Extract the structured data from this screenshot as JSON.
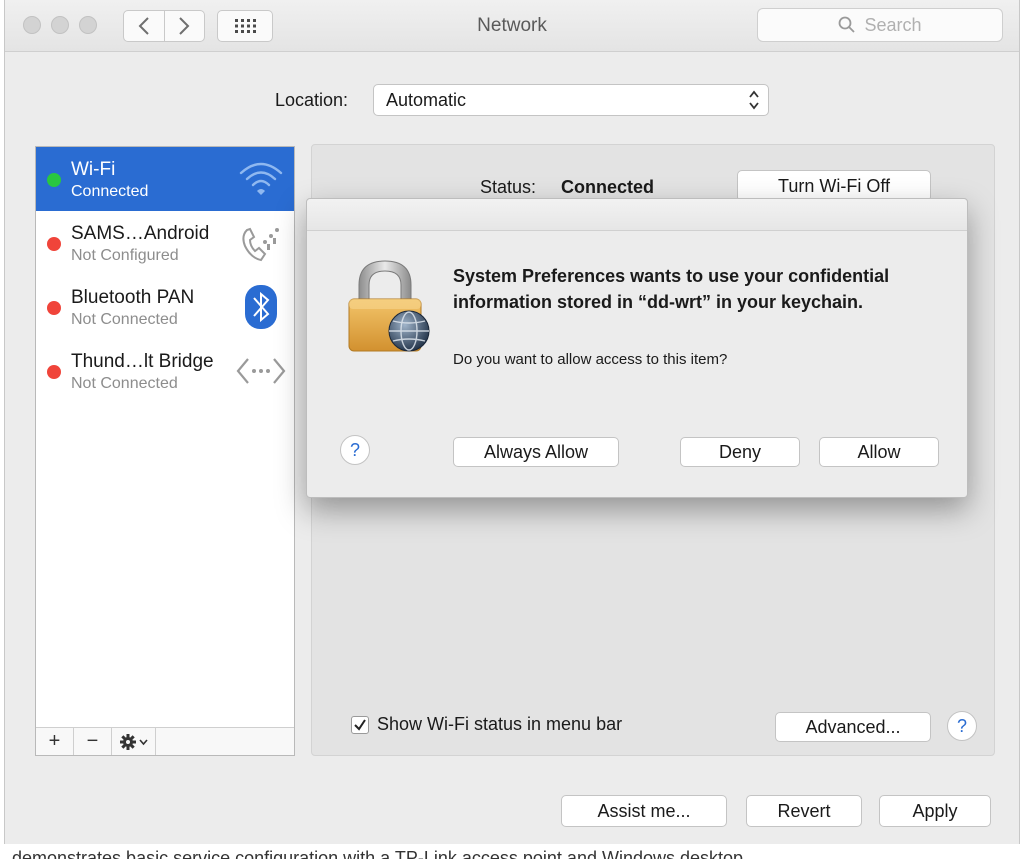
{
  "window": {
    "title": "Network",
    "search_placeholder": "Search"
  },
  "location": {
    "label": "Location:",
    "value": "Automatic"
  },
  "services": [
    {
      "name": "Wi-Fi",
      "status": "Connected",
      "dot_color": "#29c740",
      "icon": "wifi-icon",
      "selected": true
    },
    {
      "name": "SAMS…Android",
      "status": "Not Configured",
      "dot_color": "#f0443a",
      "icon": "phone-icon",
      "selected": false
    },
    {
      "name": "Bluetooth PAN",
      "status": "Not Connected",
      "dot_color": "#f0443a",
      "icon": "bluetooth-icon",
      "selected": false
    },
    {
      "name": "Thund…lt Bridge",
      "status": "Not Connected",
      "dot_color": "#f0443a",
      "icon": "thunderbolt-bridge-icon",
      "selected": false
    }
  ],
  "sidebar_toolbar": {
    "add": "+",
    "remove": "−"
  },
  "panel": {
    "status_label": "Status:",
    "status_value": "Connected",
    "turn_off_label": "Turn Wi-Fi Off",
    "show_status_label": "Show Wi-Fi status in menu bar",
    "show_status_checked": true,
    "advanced_label": "Advanced...",
    "help": "?"
  },
  "dialog": {
    "message": "System Preferences wants to use your confidential information stored in “dd-wrt” in your keychain.",
    "question": "Do you want to allow access to this item?",
    "help": "?",
    "always_allow_label": "Always Allow",
    "deny_label": "Deny",
    "allow_label": "Allow"
  },
  "footer": {
    "assist_label": "Assist me...",
    "revert_label": "Revert",
    "apply_label": "Apply"
  },
  "background_text": "demonstrates basic service configuration with a TP-Link access point and Windows desktop",
  "colors": {
    "selection": "#2a6cd2",
    "connected": "#29c740",
    "disconnected": "#f0443a"
  }
}
